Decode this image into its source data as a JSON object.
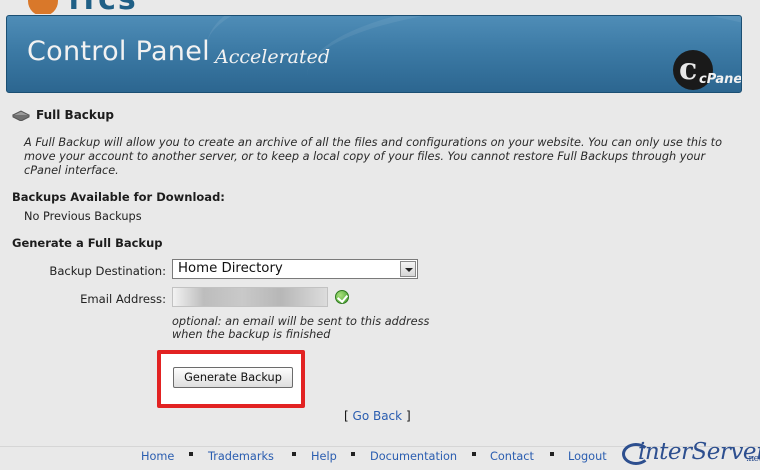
{
  "banner": {
    "title": "Control Panel",
    "subtitle": "Accelerated",
    "logo_text": "cPanel"
  },
  "top_logo": {
    "text": "ffcs"
  },
  "page": {
    "heading": "Full Backup",
    "description": "A Full Backup will allow you to create an archive of all the files and configurations on your website. You can only use this to move your account to another server, or to keep a local copy of your files. You cannot restore Full Backups through your cPanel interface.",
    "available_heading": "Backups Available for Download:",
    "available_value": "No Previous Backups",
    "generate_heading": "Generate a Full Backup"
  },
  "form": {
    "destination_label": "Backup Destination:",
    "destination_value": "Home Directory",
    "email_label": "Email Address:",
    "email_value": "",
    "email_hint": "optional: an email will be sent to this address when the backup is finished",
    "generate_label": "Generate Backup"
  },
  "nav": {
    "go_back_open": "[",
    "go_back": "Go Back",
    "go_back_close": "]"
  },
  "footer": {
    "links": [
      "Home",
      "Trademarks",
      "Help",
      "Documentation",
      "Contact",
      "Logout"
    ],
    "brand": "interServer",
    "brand_suffix": ".net"
  },
  "colors": {
    "banner_blue": "#3c7aa5",
    "highlight_red": "#e22222",
    "link_blue": "#2a5db0"
  }
}
